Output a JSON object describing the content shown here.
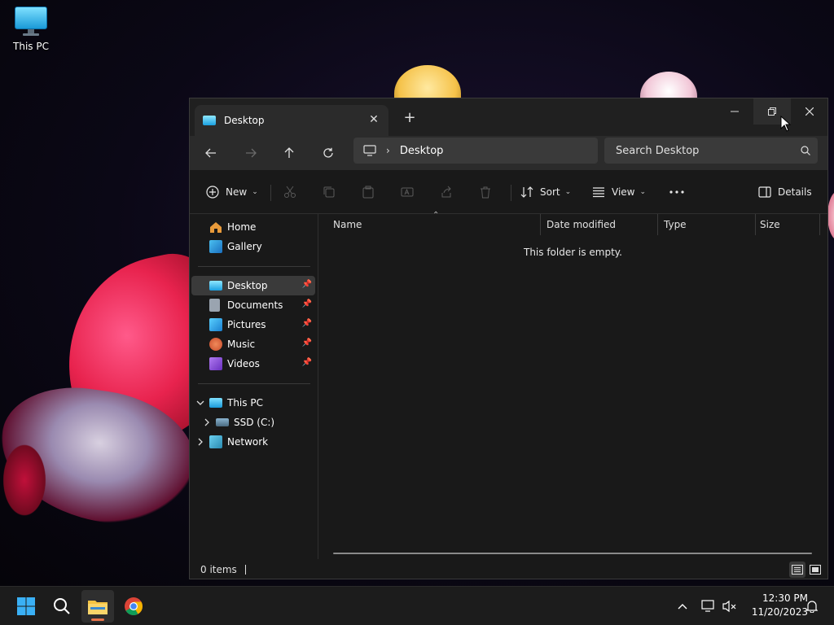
{
  "desktop": {
    "icon_label": "This PC"
  },
  "window": {
    "tab_title": "Desktop",
    "address_current": "Desktop",
    "search_placeholder": "Search Desktop"
  },
  "commandbar": {
    "new_label": "New",
    "sort_label": "Sort",
    "view_label": "View",
    "details_label": "Details"
  },
  "navpane": {
    "home": "Home",
    "gallery": "Gallery",
    "pinned": [
      {
        "label": "Desktop",
        "icon": "desktop-icon",
        "color": "#1aa0e0"
      },
      {
        "label": "Documents",
        "icon": "documents-icon",
        "color": "#9aa4b0"
      },
      {
        "label": "Pictures",
        "icon": "pictures-icon",
        "color": "#2aa8e8"
      },
      {
        "label": "Music",
        "icon": "music-icon",
        "color": "#e0603a"
      },
      {
        "label": "Videos",
        "icon": "videos-icon",
        "color": "#8a4ad8"
      }
    ],
    "this_pc": "This PC",
    "ssd": "SSD (C:)",
    "network": "Network"
  },
  "columns": [
    "Name",
    "Date modified",
    "Type",
    "Size"
  ],
  "empty_message": "This folder is empty.",
  "status": {
    "items": "0 items"
  },
  "taskbar": {
    "time": "12:30 PM",
    "date": "11/20/2023"
  },
  "colors": {
    "accent": "#e8734a",
    "window_bg": "#191919",
    "selected": "#3a3a3a"
  }
}
